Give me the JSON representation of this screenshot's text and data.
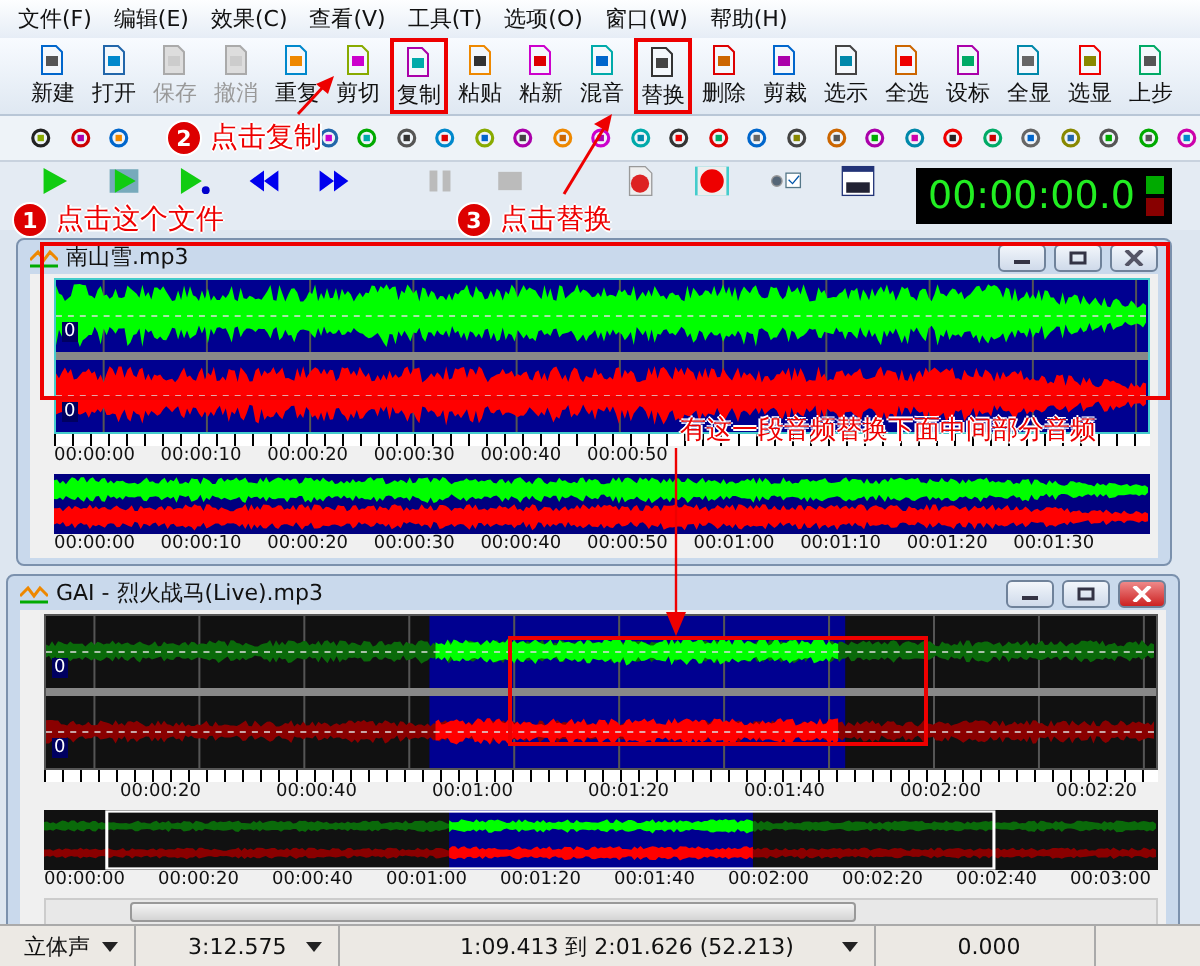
{
  "menu": [
    "文件(F)",
    "编辑(E)",
    "效果(C)",
    "查看(V)",
    "工具(T)",
    "选项(O)",
    "窗口(W)",
    "帮助(H)"
  ],
  "toolbar": [
    {
      "label": "新建",
      "disabled": false,
      "highlighted": false
    },
    {
      "label": "打开",
      "disabled": false,
      "highlighted": false
    },
    {
      "label": "保存",
      "disabled": true,
      "highlighted": false
    },
    {
      "label": "撤消",
      "disabled": true,
      "highlighted": false
    },
    {
      "label": "重复",
      "disabled": false,
      "highlighted": false
    },
    {
      "label": "剪切",
      "disabled": false,
      "highlighted": false
    },
    {
      "label": "复制",
      "disabled": false,
      "highlighted": true
    },
    {
      "label": "粘贴",
      "disabled": false,
      "highlighted": false
    },
    {
      "label": "粘新",
      "disabled": false,
      "highlighted": false
    },
    {
      "label": "混音",
      "disabled": false,
      "highlighted": false
    },
    {
      "label": "替换",
      "disabled": false,
      "highlighted": true
    },
    {
      "label": "删除",
      "disabled": false,
      "highlighted": false
    },
    {
      "label": "剪裁",
      "disabled": false,
      "highlighted": false
    },
    {
      "label": "选示",
      "disabled": false,
      "highlighted": false
    },
    {
      "label": "全选",
      "disabled": false,
      "highlighted": false
    },
    {
      "label": "设标",
      "disabled": false,
      "highlighted": false
    },
    {
      "label": "全显",
      "disabled": false,
      "highlighted": false
    },
    {
      "label": "选显",
      "disabled": false,
      "highlighted": false
    },
    {
      "label": "上步",
      "disabled": false,
      "highlighted": false
    }
  ],
  "time_display": "00:00:00.0",
  "steps": [
    {
      "number": "1",
      "text": "点击这个文件"
    },
    {
      "number": "2",
      "text": "点击复制"
    },
    {
      "number": "3",
      "text": "点击替换"
    }
  ],
  "note": "有这一段音频替换下面中间部分音频",
  "windows": [
    {
      "title": "南山雪.mp3",
      "active": false,
      "kind": "full",
      "zero_labels": [
        "0",
        "0"
      ],
      "ruler": [
        "00:00:00",
        "00:00:10",
        "00:00:20",
        "00:00:30",
        "00:00:40",
        "00:00:50"
      ],
      "overview_ruler": [
        "00:00:00",
        "00:00:10",
        "00:00:20",
        "00:00:30",
        "00:00:40",
        "00:00:50",
        "00:01:00",
        "00:01:10",
        "00:01:20",
        "00:01:30"
      ]
    },
    {
      "title": "GAI - 烈火战马(Live).mp3",
      "active": true,
      "kind": "partial",
      "zero_labels": [
        "0",
        "0"
      ],
      "ruler": [
        "00:00:20",
        "00:00:40",
        "00:01:00",
        "00:01:20",
        "00:01:40",
        "00:02:00",
        "00:02:20"
      ],
      "overview_ruler": [
        "00:00:00",
        "00:00:20",
        "00:00:40",
        "00:01:00",
        "00:01:20",
        "00:01:40",
        "00:02:00",
        "00:02:20",
        "00:02:40",
        "00:03:00"
      ]
    }
  ],
  "status_bar": [
    {
      "text": "立体声",
      "dropdown": true
    },
    {
      "text": "3:12.575",
      "dropdown": true
    },
    {
      "text": "1:09.413 到 2:01.626 (52.213)",
      "dropdown": true
    },
    {
      "text": "0.000",
      "dropdown": false
    }
  ]
}
